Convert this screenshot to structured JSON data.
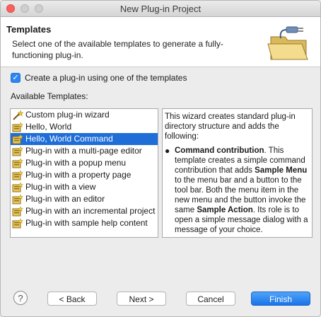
{
  "window": {
    "title": "New Plug-in Project"
  },
  "banner": {
    "title": "Templates",
    "description": "Select one of the available templates to generate a fully-functioning plug-in."
  },
  "checkbox": {
    "label": "Create a plug-in using one of the templates",
    "checked": true
  },
  "available_label": "Available Templates:",
  "templates": [
    {
      "label": "Custom plug-in wizard",
      "icon": "wizard-icon",
      "selected": false
    },
    {
      "label": "Hello, World",
      "icon": "plugin-template-icon",
      "selected": false
    },
    {
      "label": "Hello, World Command",
      "icon": "plugin-template-icon",
      "selected": true
    },
    {
      "label": "Plug-in with a multi-page editor",
      "icon": "plugin-template-icon",
      "selected": false
    },
    {
      "label": "Plug-in with a popup menu",
      "icon": "plugin-template-icon",
      "selected": false
    },
    {
      "label": "Plug-in with a property page",
      "icon": "plugin-template-icon",
      "selected": false
    },
    {
      "label": "Plug-in with a view",
      "icon": "plugin-template-icon",
      "selected": false
    },
    {
      "label": "Plug-in with an editor",
      "icon": "plugin-template-icon",
      "selected": false
    },
    {
      "label": "Plug-in with an incremental project b",
      "icon": "plugin-template-icon",
      "selected": false
    },
    {
      "label": "Plug-in with sample help content",
      "icon": "plugin-template-icon",
      "selected": false
    }
  ],
  "description": {
    "intro": "This wizard creates standard plug-in directory structure and adds the following:",
    "bullet_title": "Command contribution",
    "bullet_text_1": ". This template creates a simple command contribution that adds ",
    "bold_1": "Sample Menu",
    "bullet_text_2": " to the menu bar and a button to the tool bar. Both the menu item in the new menu and the button invoke the same ",
    "bold_2": "Sample Action",
    "bullet_text_3": ". Its role is to open a simple message dialog with a message of your choice."
  },
  "buttons": {
    "help": "?",
    "back": "< Back",
    "next": "Next >",
    "cancel": "Cancel",
    "finish": "Finish"
  },
  "colors": {
    "accent": "#1f6ed8",
    "primary_button": "#1a73e8",
    "checkbox": "#2f86f0"
  }
}
